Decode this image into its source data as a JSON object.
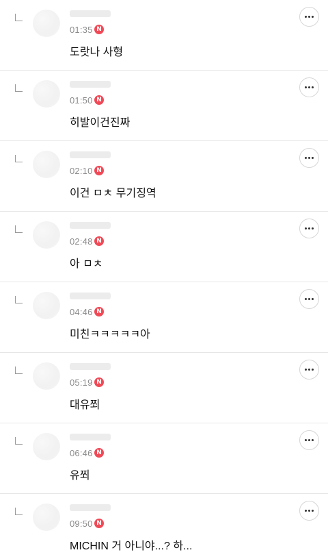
{
  "badge_label": "N",
  "colors": {
    "badge": "#f04a57",
    "divider": "#e6e6e6",
    "time": "#8c8c8c"
  },
  "icons": {
    "reply": "reply-arrow-icon",
    "more": "more-options-icon",
    "badge": "new-badge-icon"
  },
  "comments": [
    {
      "time": "01:35",
      "text": "도랏나 사형"
    },
    {
      "time": "01:50",
      "text": "히발이건진짜"
    },
    {
      "time": "02:10",
      "text": "이건 ㅁㅊ 무기징역"
    },
    {
      "time": "02:48",
      "text": "아 ㅁㅊ"
    },
    {
      "time": "04:46",
      "text": "미친ㅋㅋㅋㅋㅋ아"
    },
    {
      "time": "05:19",
      "text": "대유쬐"
    },
    {
      "time": "06:46",
      "text": "유쬐"
    },
    {
      "time": "09:50",
      "text": "MICHIN 거 아니야...? 하..."
    }
  ]
}
